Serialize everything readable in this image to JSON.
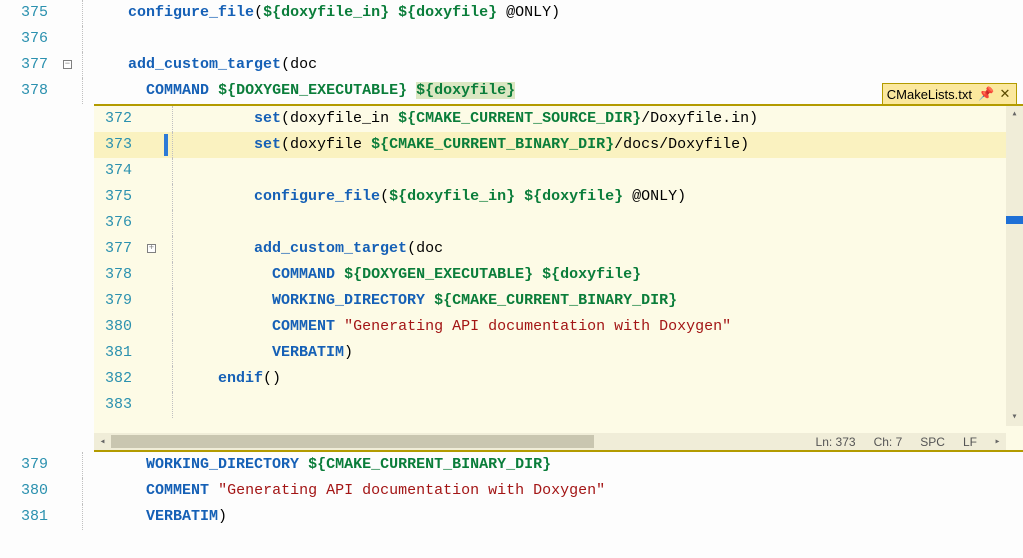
{
  "outer": {
    "lines": [
      {
        "n": 375,
        "fold": "",
        "code": [
          [
            "",
            "    "
          ],
          [
            "fn",
            "configure_file"
          ],
          [
            "txt",
            "("
          ],
          [
            "var",
            "${doxyfile_in}"
          ],
          [
            "txt",
            " "
          ],
          [
            "var",
            "${doxyfile}"
          ],
          [
            "txt",
            " @ONLY)"
          ]
        ]
      },
      {
        "n": 376,
        "fold": "",
        "code": [
          [
            "",
            ""
          ]
        ]
      },
      {
        "n": 377,
        "fold": "minus",
        "code": [
          [
            "",
            "    "
          ],
          [
            "fn",
            "add_custom_target"
          ],
          [
            "txt",
            "(doc"
          ]
        ]
      },
      {
        "n": 378,
        "fold": "",
        "code": [
          [
            "",
            "      "
          ],
          [
            "kw2",
            "COMMAND"
          ],
          [
            "txt",
            " "
          ],
          [
            "var",
            "${DOXYGEN_EXECUTABLE}"
          ],
          [
            "txt",
            " "
          ],
          [
            "hl var",
            "${doxyfile}"
          ]
        ]
      }
    ],
    "bottom": [
      {
        "n": 379,
        "code": [
          [
            "",
            "      "
          ],
          [
            "kw2",
            "WORKING_DIRECTORY"
          ],
          [
            "txt",
            " "
          ],
          [
            "var",
            "${CMAKE_CURRENT_BINARY_DIR}"
          ]
        ]
      },
      {
        "n": 380,
        "code": [
          [
            "",
            "      "
          ],
          [
            "kw2",
            "COMMENT"
          ],
          [
            "txt",
            " "
          ],
          [
            "str",
            "\"Generating API documentation with Doxygen\""
          ]
        ]
      },
      {
        "n": 381,
        "code": [
          [
            "",
            "      "
          ],
          [
            "kw2",
            "VERBATIM"
          ],
          [
            "txt",
            ")"
          ]
        ]
      }
    ]
  },
  "peek": {
    "tabTitle": "CMakeLists.txt",
    "status": {
      "ln_label": "Ln:",
      "ln": 373,
      "ch_label": "Ch:",
      "ch": 7,
      "spc": "SPC",
      "lf": "LF"
    },
    "lines": [
      {
        "n": 372,
        "changed": false,
        "code": [
          [
            "",
            "        "
          ],
          [
            "fn",
            "set"
          ],
          [
            "txt",
            "(doxyfile_in "
          ],
          [
            "var",
            "${CMAKE_CURRENT_SOURCE_DIR}"
          ],
          [
            "txt",
            "/Doxyfile.in)"
          ]
        ]
      },
      {
        "n": 373,
        "changed": true,
        "current": true,
        "code": [
          [
            "",
            "        "
          ],
          [
            "fn",
            "set"
          ],
          [
            "txt",
            "(doxyfile "
          ],
          [
            "var",
            "${CMAKE_CURRENT_BINARY_DIR}"
          ],
          [
            "txt",
            "/docs/Doxyfile)"
          ]
        ]
      },
      {
        "n": 374,
        "changed": false,
        "code": [
          [
            "",
            ""
          ]
        ]
      },
      {
        "n": 375,
        "changed": false,
        "code": [
          [
            "",
            "        "
          ],
          [
            "fn",
            "configure_file"
          ],
          [
            "txt",
            "("
          ],
          [
            "var",
            "${doxyfile_in}"
          ],
          [
            "txt",
            " "
          ],
          [
            "var",
            "${doxyfile}"
          ],
          [
            "txt",
            " @ONLY)"
          ]
        ]
      },
      {
        "n": 376,
        "changed": false,
        "code": [
          [
            "",
            ""
          ]
        ]
      },
      {
        "n": 377,
        "changed": false,
        "fold": "plus",
        "code": [
          [
            "",
            "        "
          ],
          [
            "fn",
            "add_custom_target"
          ],
          [
            "txt",
            "(doc"
          ]
        ]
      },
      {
        "n": 378,
        "changed": false,
        "code": [
          [
            "",
            "          "
          ],
          [
            "kw2",
            "COMMAND"
          ],
          [
            "txt",
            " "
          ],
          [
            "var",
            "${DOXYGEN_EXECUTABLE}"
          ],
          [
            "txt",
            " "
          ],
          [
            "var",
            "${doxyfile}"
          ]
        ]
      },
      {
        "n": 379,
        "changed": false,
        "code": [
          [
            "",
            "          "
          ],
          [
            "kw2",
            "WORKING_DIRECTORY"
          ],
          [
            "txt",
            " "
          ],
          [
            "var",
            "${CMAKE_CURRENT_BINARY_DIR}"
          ]
        ]
      },
      {
        "n": 380,
        "changed": false,
        "code": [
          [
            "",
            "          "
          ],
          [
            "kw2",
            "COMMENT"
          ],
          [
            "txt",
            " "
          ],
          [
            "str",
            "\"Generating API documentation with Doxygen\""
          ]
        ]
      },
      {
        "n": 381,
        "changed": false,
        "code": [
          [
            "",
            "          "
          ],
          [
            "kw2",
            "VERBATIM"
          ],
          [
            "txt",
            ")"
          ]
        ]
      },
      {
        "n": 382,
        "changed": false,
        "code": [
          [
            "",
            "    "
          ],
          [
            "fn",
            "endif"
          ],
          [
            "txt",
            "()"
          ]
        ]
      },
      {
        "n": 383,
        "changed": false,
        "code": [
          [
            "",
            ""
          ]
        ]
      }
    ]
  }
}
